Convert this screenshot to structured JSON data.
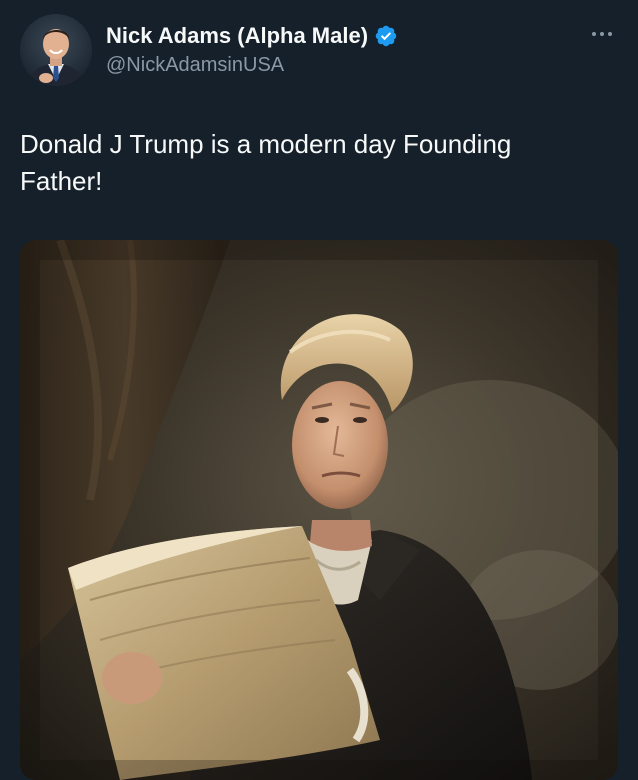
{
  "tweet": {
    "author": {
      "display_name": "Nick Adams (Alpha Male)",
      "handle": "@NickAdamsinUSA",
      "verified": true,
      "avatar_icon": "user-avatar-photo",
      "verified_icon": "verified-badge-icon"
    },
    "text": "Donald J Trump is a modern day Founding Father!",
    "more_icon": "more-options-icon",
    "media": {
      "type": "image",
      "subject": "painted-portrait"
    }
  },
  "colors": {
    "background": "#15202b",
    "primary_text": "#f7f9f9",
    "secondary_text": "#8b98a5",
    "verified_blue": "#1d9bf0"
  }
}
